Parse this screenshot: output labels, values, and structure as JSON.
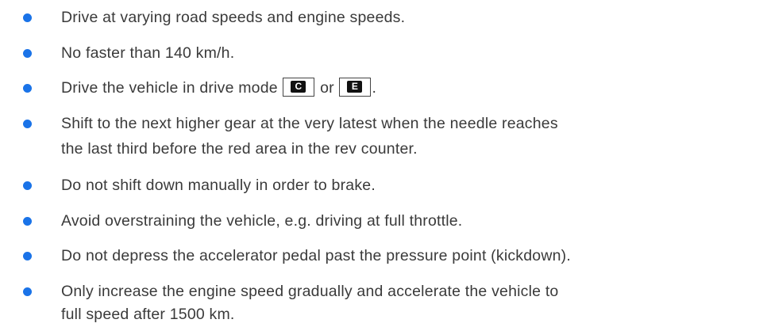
{
  "bullet_color": "#1a73e8",
  "items": [
    {
      "text": "Drive at varying road speeds and engine speeds."
    },
    {
      "text": "No faster than 140 km/h."
    },
    {
      "prefix": "Drive the vehicle in drive mode",
      "mode_c": "C",
      "connector": "or",
      "mode_e": "E",
      "suffix": "."
    },
    {
      "line1": "Shift to the next higher gear at the very latest when the needle reaches",
      "line2": "the last third before the red area in the rev counter."
    },
    {
      "text": "Do not shift down manually in order to brake."
    },
    {
      "text": "Avoid overstraining the vehicle, e.g. driving at full throttle."
    },
    {
      "text": "Do not depress the accelerator pedal past the pressure point (kickdown)."
    },
    {
      "line1": "Only increase the engine speed gradually and accelerate the vehicle to",
      "line2": "full speed after 1500 km."
    }
  ]
}
